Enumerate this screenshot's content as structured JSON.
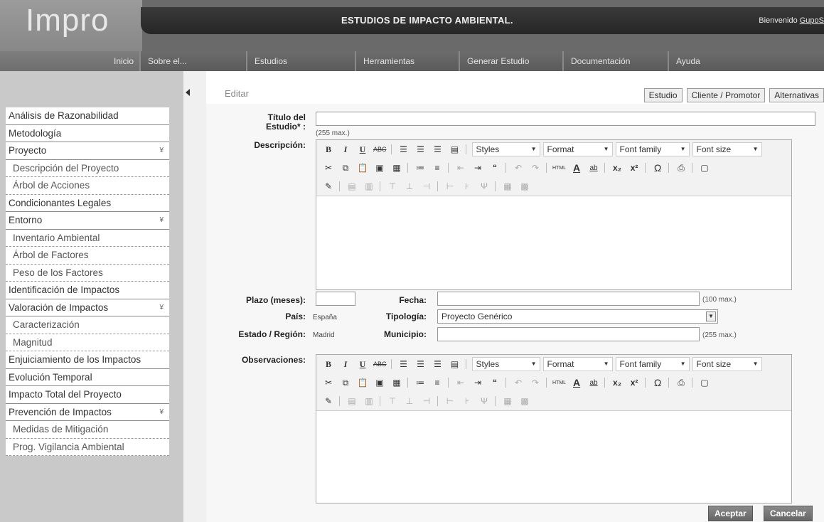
{
  "header": {
    "logo": "Impro",
    "title": "ESTUDIOS DE IMPACTO AMBIENTAL.",
    "welcome_prefix": "Bienvenido ",
    "welcome_user": "GupoS"
  },
  "nav": [
    "Inicio",
    "Sobre el...",
    "Estudios",
    "Herramientas",
    "Generar Estudio",
    "Documentación",
    "Ayuda"
  ],
  "sidebar": [
    {
      "label": "Análisis de Razonabilidad",
      "sub": false,
      "caret": ""
    },
    {
      "label": "Metodología",
      "sub": false,
      "caret": ""
    },
    {
      "label": "Proyecto",
      "sub": false,
      "caret": "¥"
    },
    {
      "label": "Descripción del Proyecto",
      "sub": true,
      "caret": ""
    },
    {
      "label": "Árbol de Acciones",
      "sub": true,
      "caret": ""
    },
    {
      "label": "Condicionantes Legales",
      "sub": false,
      "caret": ""
    },
    {
      "label": "Entorno",
      "sub": false,
      "caret": "¥"
    },
    {
      "label": "Inventario Ambiental",
      "sub": true,
      "caret": ""
    },
    {
      "label": "Árbol de Factores",
      "sub": true,
      "caret": ""
    },
    {
      "label": "Peso de los Factores",
      "sub": true,
      "caret": ""
    },
    {
      "label": "Identificación de Impactos",
      "sub": false,
      "caret": ""
    },
    {
      "label": "Valoración de Impactos",
      "sub": false,
      "caret": "¥"
    },
    {
      "label": "Caracterización",
      "sub": true,
      "caret": ""
    },
    {
      "label": "Magnitud",
      "sub": true,
      "caret": ""
    },
    {
      "label": "Enjuiciamiento de los Impactos",
      "sub": false,
      "caret": ""
    },
    {
      "label": "Evolución Temporal",
      "sub": false,
      "caret": ""
    },
    {
      "label": "Impacto Total del Proyecto",
      "sub": false,
      "caret": ""
    },
    {
      "label": "Prevención de Impactos",
      "sub": false,
      "caret": "¥"
    },
    {
      "label": "Medidas de Mitigación",
      "sub": true,
      "caret": ""
    },
    {
      "label": "Prog. Vigilancia Ambiental",
      "sub": true,
      "caret": ""
    }
  ],
  "content": {
    "edit_label": "Editar",
    "tabs": [
      "Estudio",
      "Cliente / Promotor",
      "Alternativas"
    ]
  },
  "form": {
    "titulo_label": "Título del Estudio* :",
    "titulo_value": "",
    "titulo_hint": "(255 max.)",
    "descripcion_label": "Descripción:",
    "plazo_label": "Plazo (meses):",
    "plazo_value": "",
    "fecha_label": "Fecha:",
    "fecha_value": "",
    "fecha_hint": "(100 max.)",
    "pais_label": "País:",
    "pais_value": "España",
    "tipologia_label": "Tipología:",
    "tipologia_value": "Proyecto Genérico",
    "estado_label": "Estado / Región:",
    "estado_value": "Madrid",
    "municipio_label": "Municipio:",
    "municipio_value": "",
    "municipio_hint": "(255 max.)",
    "observaciones_label": "Observaciones:"
  },
  "editor": {
    "styles": "Styles",
    "format": "Format",
    "font_family": "Font family",
    "font_size": "Font size"
  },
  "buttons": {
    "accept": "Aceptar",
    "cancel": "Cancelar"
  }
}
